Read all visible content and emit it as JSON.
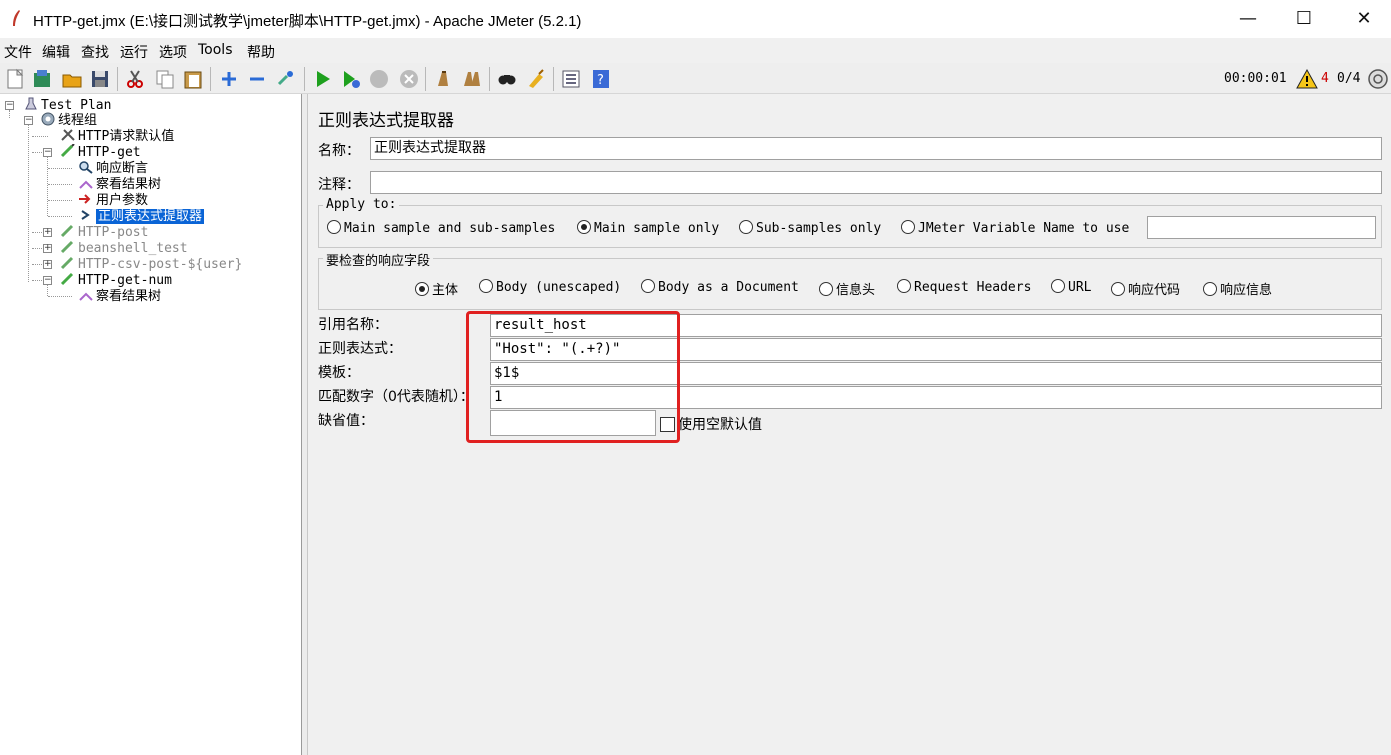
{
  "window": {
    "title": "HTTP-get.jmx (E:\\接口测试教学\\jmeter脚本\\HTTP-get.jmx) - Apache JMeter (5.2.1)",
    "minimize": "—",
    "maximize": "☐",
    "close": "✕"
  },
  "menu": [
    "文件",
    "编辑",
    "查找",
    "运行",
    "选项",
    "Tools",
    "帮助"
  ],
  "toolbar": {
    "icons": [
      "new-icon",
      "templates-icon",
      "open-icon",
      "save-icon",
      "cut-icon",
      "copy-icon",
      "paste-icon",
      "expand-icon",
      "collapse-icon",
      "toggle-icon",
      "start-icon",
      "start-no-pause-icon",
      "stop-icon",
      "shutdown-icon",
      "clear-icon",
      "clear-all-icon",
      "search-icon",
      "reset-search-icon",
      "function-helper-icon",
      "help-icon"
    ],
    "timer": "00:00:01",
    "error_count": "4",
    "threads": "0/4"
  },
  "tree": {
    "test_plan": "Test Plan",
    "thread_group": "线程组",
    "http_defaults": "HTTP请求默认值",
    "http_get": "HTTP-get",
    "assertion": "响应断言",
    "view_results": "察看结果树",
    "user_params": "用户参数",
    "regex_extractor": "正则表达式提取器",
    "http_post": "HTTP-post",
    "beanshell": "beanshell_test",
    "csv_post": "HTTP-csv-post-${user}",
    "get_num": "HTTP-get-num",
    "view_results_2": "察看结果树"
  },
  "panel": {
    "title": "正则表达式提取器",
    "name_label": "名称：",
    "name_value": "正则表达式提取器",
    "comment_label": "注释：",
    "comment_value": "",
    "apply_to": {
      "legend": "Apply to:",
      "options": [
        "Main sample and sub-samples",
        "Main sample only",
        "Sub-samples only",
        "JMeter Variable Name to use"
      ],
      "selected": 1,
      "variable_value": ""
    },
    "field_to_check": {
      "legend": "要检查的响应字段",
      "options": [
        "主体",
        "Body (unescaped)",
        "Body as a Document",
        "信息头",
        "Request Headers",
        "URL",
        "响应代码",
        "响应信息"
      ],
      "selected": 0
    },
    "ref_name_label": "引用名称：",
    "ref_name_value": "result_host",
    "regex_label": "正则表达式：",
    "regex_value": "\"Host\": \"(.+?)\"",
    "template_label": "模板：",
    "template_value": "$1$",
    "match_no_label": "匹配数字（0代表随机）：",
    "match_no_value": "1",
    "default_label": "缺省值：",
    "default_value": "",
    "use_empty_label": "使用空默认值",
    "use_empty_checked": false
  },
  "colors": {
    "selection": "#0a64d6",
    "highlight_box": "#e02020",
    "error_count": "#cc0000"
  }
}
